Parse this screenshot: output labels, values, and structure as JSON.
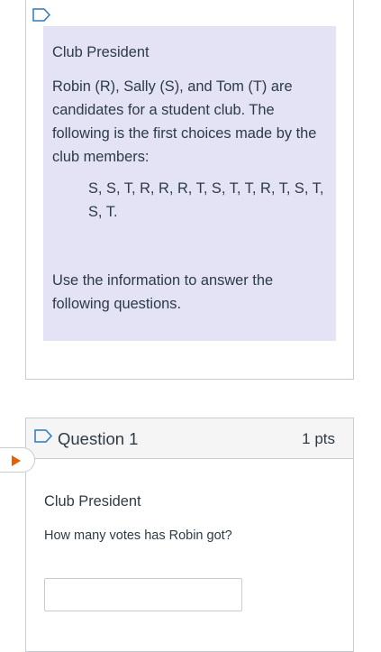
{
  "stimulus": {
    "title": "Club President",
    "description": "Robin (R), Sally (S), and Tom (T) are candidates for a student club. The following is the first choices made by the club members:",
    "votes_line1": "S, S, T, R, R, R, T, S, T, T, R, T, S, T,",
    "votes_line2": "S, T.",
    "instruction": "Use the information to answer the following questions."
  },
  "question": {
    "title": "Question 1",
    "points": "1 pts",
    "name": "Club President",
    "text": "How many votes has Robin got?",
    "answer_value": ""
  },
  "icons": {
    "flag": "bookmark-flag-icon",
    "current": "play-arrow-icon"
  },
  "colors": {
    "stimulus_bg": "#e3e3f5",
    "flag_stroke": "#2b7abc",
    "arrow_fill": "#e66000"
  }
}
